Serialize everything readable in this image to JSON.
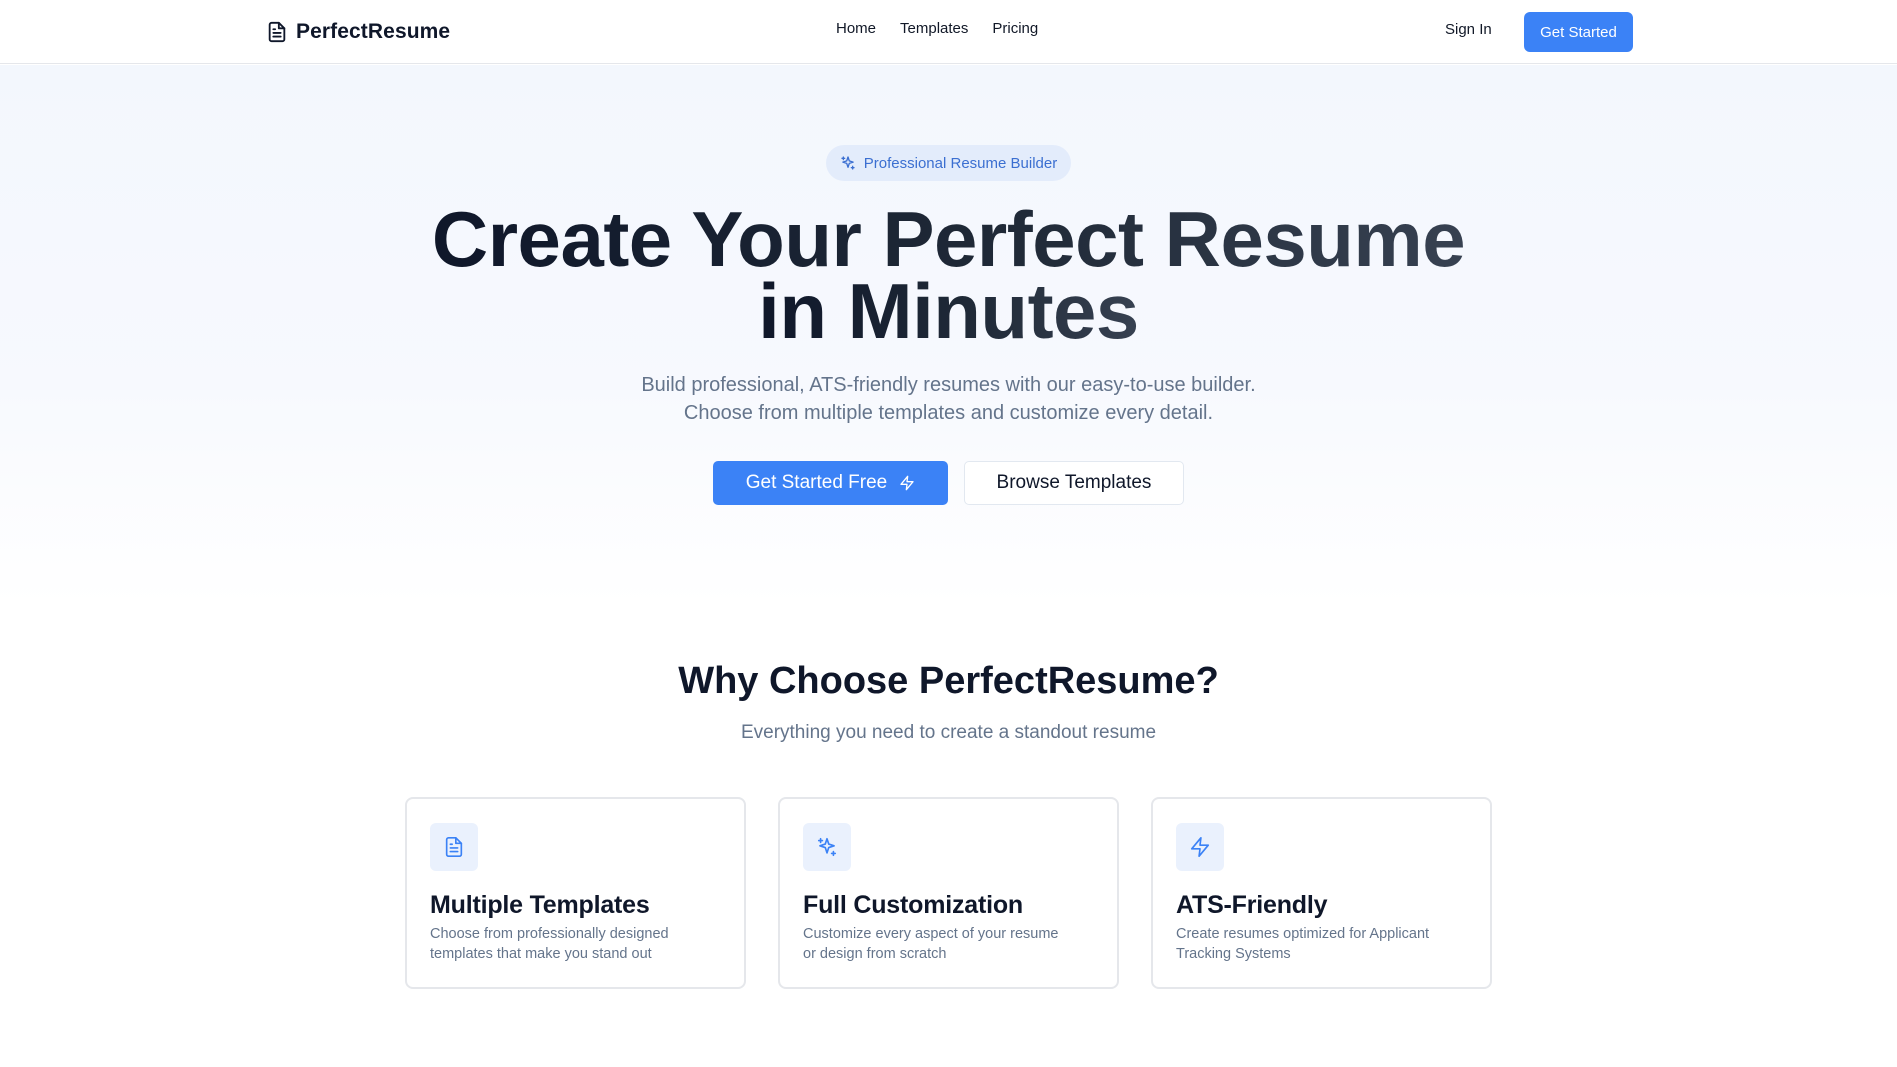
{
  "nav": {
    "brand": "PerfectResume",
    "links": [
      "Home",
      "Templates",
      "Pricing"
    ],
    "sign_in": "Sign In",
    "cta": "Get Started"
  },
  "hero": {
    "badge": "Professional Resume Builder",
    "title_line1": "Create Your Perfect Resume",
    "title_line2": "in Minutes",
    "subtitle_line1": "Build professional, ATS-friendly resumes with our easy-to-use builder.",
    "subtitle_line2": "Choose from multiple templates and customize every detail.",
    "primary_button": "Get Started Free",
    "secondary_button": "Browse Templates"
  },
  "features": {
    "title": "Why Choose PerfectResume?",
    "subtitle": "Everything you need to create a standout resume",
    "cards": [
      {
        "icon": "file-text-icon",
        "title": "Multiple Templates",
        "description": "Choose from professionally designed templates that make you stand out"
      },
      {
        "icon": "sparkles-icon",
        "title": "Full Customization",
        "description": "Customize every aspect of your resume or design from scratch"
      },
      {
        "icon": "zap-icon",
        "title": "ATS-Friendly",
        "description": "Create resumes optimized for Applicant Tracking Systems"
      }
    ]
  },
  "colors": {
    "accent": "#3b82f6",
    "badge_bg": "#e3ecfb",
    "icon_bg": "#eaf1fd",
    "muted_text": "#64748b"
  }
}
